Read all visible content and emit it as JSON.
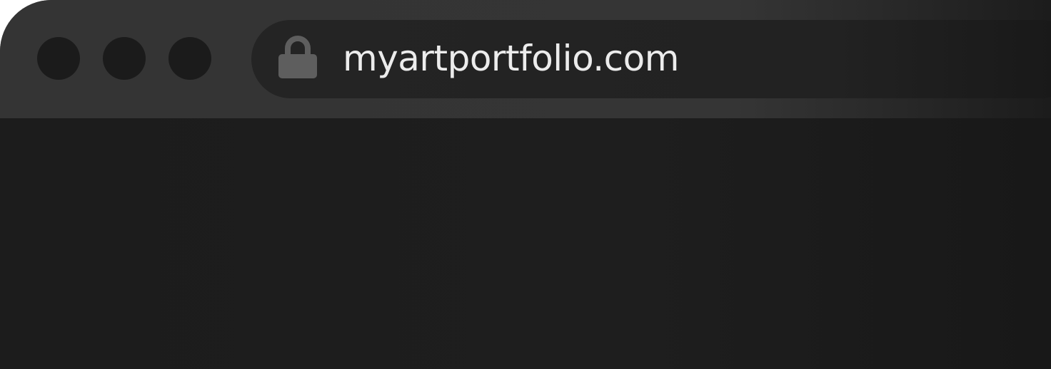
{
  "window": {
    "controls": [
      {
        "name": "close-button"
      },
      {
        "name": "minimize-button"
      },
      {
        "name": "maximize-button"
      }
    ]
  },
  "address_bar": {
    "icon": "lock-icon",
    "url": "myartportfolio.com"
  },
  "colors": {
    "toolbar": "#353535",
    "address_bar": "#232323",
    "content": "#1c1c1c",
    "url_text": "#ececec",
    "lock_icon": "#5e5e5e"
  }
}
